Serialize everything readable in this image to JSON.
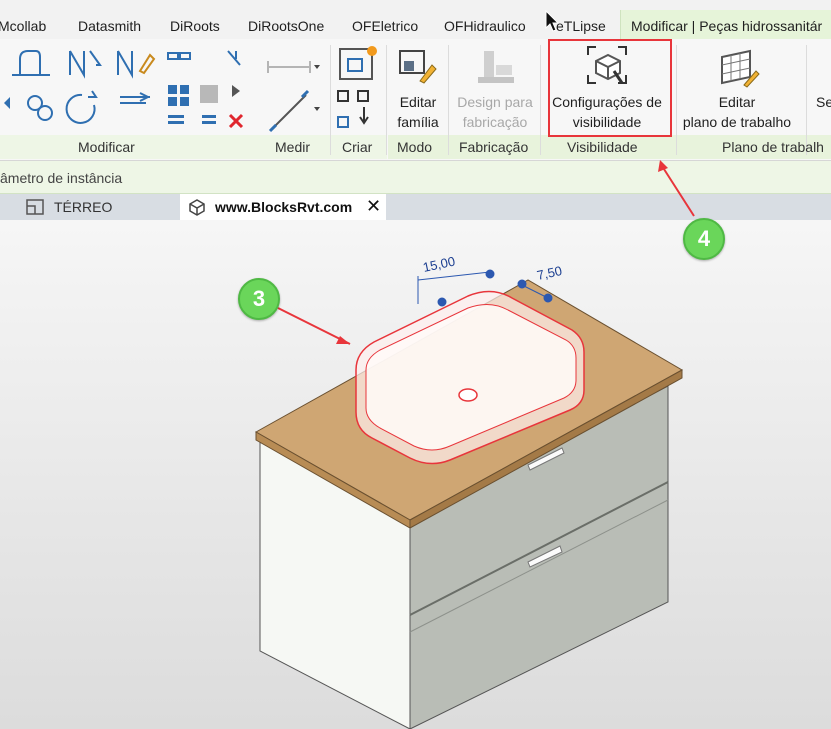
{
  "tabs": [
    "Mcollab",
    "Datasmith",
    "DiRoots",
    "DiRootsOne",
    "OFEletrico",
    "OFHidraulico",
    "eTLipse"
  ],
  "context_tab": "Modificar | Peças hidrossanitár",
  "ribbon": {
    "panels": {
      "modificar": "Modificar",
      "medir": "Medir",
      "criar": "Criar",
      "modo": "Modo",
      "fabricacao": "Fabricação",
      "visibilidade": "Visibilidade",
      "plano": "Plano de trabalh"
    },
    "buttons": {
      "editar_familia": [
        "Editar",
        "família"
      ],
      "design_fabricacao": [
        "Design para",
        "fabricação"
      ],
      "config_visibilidade": [
        "Configurações de",
        "visibilidade"
      ],
      "editar_plano": [
        "Editar",
        "plano de trabalho"
      ],
      "partial": "Se"
    }
  },
  "options_bar": {
    "text": "âmetro de instância"
  },
  "doc_tabs": {
    "inactive": "TÉRREO",
    "active": "www.BlocksRvt.com",
    "close": "✕"
  },
  "viewport": {
    "dim_1": "15,00",
    "dim_2": "7,50"
  },
  "callouts": [
    "3",
    "4"
  ],
  "colors": {
    "highlight": "#e8353b",
    "callout": "#6ad65a",
    "context_tab": "#e6f4d9"
  }
}
